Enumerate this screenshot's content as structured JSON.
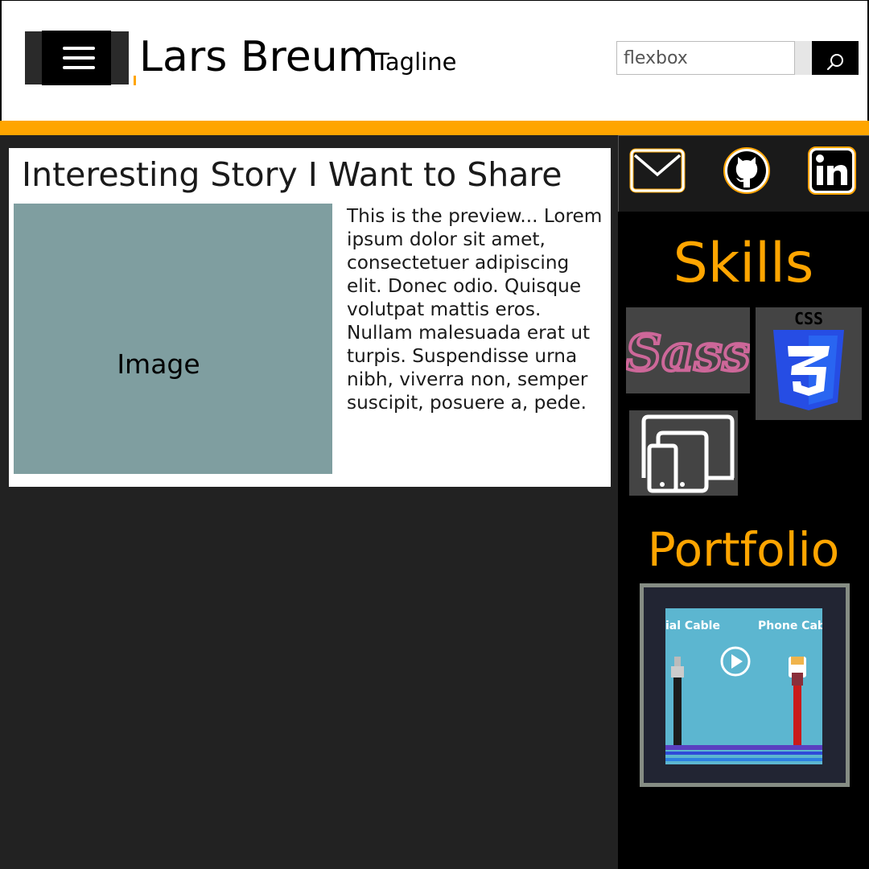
{
  "header": {
    "site_title": "Lars Breum",
    "tagline": "Tagline",
    "search_placeholder": "flexbox"
  },
  "article": {
    "title": "Interesting Story I Want to Share",
    "image_placeholder": "Image",
    "preview": "This is the preview... Lorem ipsum dolor sit amet, consectetuer adipiscing elit. Donec odio. Quisque volutpat mattis eros. Nullam malesuada erat ut turpis. Suspendisse urna nibh, viverra non, semper suscipit, posuere a, pede."
  },
  "sidebar": {
    "social_icons": [
      "mail-icon",
      "github-icon",
      "linkedin-icon"
    ],
    "skills_title": "Skills",
    "skill_icons": [
      "sass-logo",
      "css3-logo",
      "responsive-devices-icon"
    ],
    "css3_logo_text": "CSS",
    "sass_logo_text": "Sass",
    "portfolio_title": "Portfolio",
    "portfolio_thumb_labels": [
      "ial Cable",
      "Phone Cab"
    ]
  },
  "colors": {
    "accent": "#ffa500",
    "page_background": "#222222",
    "sidebar_background": "#000000",
    "image_placeholder": "#7f9ea0",
    "sass_pink": "#cd6799",
    "css3_blue": "#264de4"
  }
}
